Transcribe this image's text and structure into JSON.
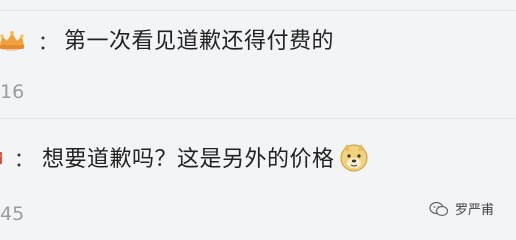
{
  "comments": [
    {
      "badge": "crown-badge-icon",
      "separator": "：",
      "text": "第一次看见道歉还得付费的",
      "likes": "16"
    },
    {
      "badge": "red-badge-icon",
      "separator": "：",
      "text": "想要道歉吗？这是另外的价格",
      "emoji": "doge-emoji-icon",
      "likes": "45"
    }
  ],
  "watermark": {
    "icon": "wechat-icon",
    "text": "罗严甫"
  },
  "colors": {
    "background": "#f3f4f6",
    "text": "#222222",
    "likes": "#9a9ca3"
  }
}
